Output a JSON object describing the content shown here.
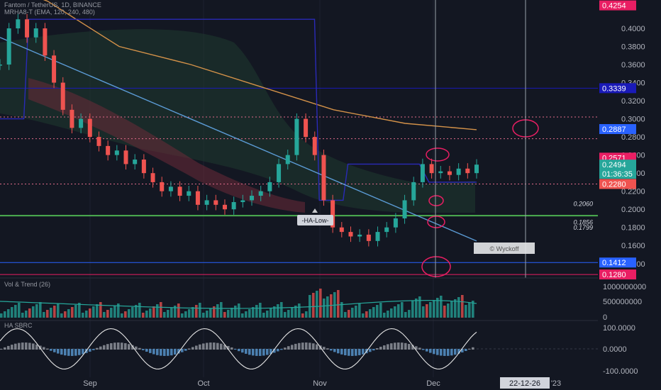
{
  "header": {
    "symbol_line": "Fantom / TetherUS, 1D, BINANCE",
    "indicator_line": "MRHA8-T (EMA, 120, 240, 480)"
  },
  "chart_data": [
    {
      "type": "candlestick",
      "title": "Fantom / TetherUS, 1D, BINANCE",
      "xlabel": "",
      "ylabel": "",
      "y_scale": "linear",
      "ylim": [
        0.125,
        0.435
      ],
      "x_tick_labels": [
        "Sep",
        "Oct",
        "Nov",
        "Dec",
        "'23"
      ],
      "y_tick_labels": [
        "0.4000",
        "0.3800",
        "0.3600",
        "0.3400",
        "0.3200",
        "0.3000",
        "0.2800",
        "0.2600",
        "0.2400",
        "0.2200",
        "0.2000",
        "0.1800",
        "0.1600",
        "0.1400"
      ],
      "price_labels": [
        {
          "text": "0.4254",
          "value": 0.4254,
          "color": "#e91e63"
        },
        {
          "text": "0.3339",
          "value": 0.3339,
          "color": "#1a1ab8"
        },
        {
          "text": "0.2887",
          "value": 0.2887,
          "color": "#2962ff"
        },
        {
          "text": "0.2571",
          "value": 0.2571,
          "color": "#e91e63"
        },
        {
          "text": "0.2494",
          "value": 0.2494,
          "color": "#26a69a"
        },
        {
          "text": "01:36:35",
          "value": 0.2494,
          "color": "#26a69a"
        },
        {
          "text": "0.2280",
          "value": 0.228,
          "color": "#ef5350"
        },
        {
          "text": "0.1412",
          "value": 0.1412,
          "color": "#2962ff"
        },
        {
          "text": "0.1280",
          "value": 0.128,
          "color": "#e91e63"
        }
      ],
      "level_annotations": [
        {
          "text": "0.2060",
          "value": 0.206
        },
        {
          "text": "0.1856",
          "value": 0.1856
        },
        {
          "text": "0.1799",
          "value": 0.1799
        }
      ],
      "callout": {
        "text": "-HA-Low-",
        "value": 0.192
      },
      "watermark_text": "© Wyckoff",
      "date_cursor_label": "22-12-26",
      "horizontal_levels": [
        {
          "value": 0.3339,
          "color": "#1a1ab8"
        },
        {
          "value": 0.193,
          "color": "#4caf50"
        },
        {
          "value": 0.302,
          "color": "#e06b8a"
        },
        {
          "value": 0.278,
          "color": "#e06b8a"
        },
        {
          "value": 0.228,
          "color": "#e06b8a"
        },
        {
          "value": 0.1412,
          "color": "#2962ff"
        },
        {
          "value": 0.128,
          "color": "#e91e63"
        }
      ],
      "close_path": [
        0.36,
        0.4,
        0.41,
        0.39,
        0.4,
        0.37,
        0.34,
        0.31,
        0.29,
        0.3,
        0.28,
        0.27,
        0.26,
        0.265,
        0.25,
        0.255,
        0.24,
        0.23,
        0.22,
        0.225,
        0.215,
        0.22,
        0.205,
        0.21,
        0.205,
        0.2,
        0.208,
        0.21,
        0.215,
        0.22,
        0.23,
        0.25,
        0.26,
        0.3,
        0.28,
        0.26,
        0.21,
        0.18,
        0.175,
        0.17,
        0.172,
        0.165,
        0.175,
        0.18,
        0.19,
        0.21,
        0.23,
        0.25,
        0.24,
        0.242,
        0.238,
        0.245,
        0.24,
        0.2494
      ],
      "series": [
        {
          "name": "",
          "color": "#d49249",
          "points": [
            [
              0,
              0.45
            ],
            [
              0.1,
              0.43
            ],
            [
              0.25,
              0.38
            ],
            [
              0.4,
              0.36
            ],
            [
              0.55,
              0.335
            ],
            [
              0.7,
              0.31
            ],
            [
              0.85,
              0.295
            ],
            [
              1.0,
              0.288
            ]
          ]
        },
        {
          "name": "",
          "color": "#2a2ab8",
          "points": [
            [
              0,
              0.3
            ],
            [
              0.05,
              0.3
            ],
            [
              0.06,
              0.41
            ],
            [
              0.66,
              0.41
            ],
            [
              0.67,
              0.21
            ],
            [
              0.72,
              0.21
            ],
            [
              0.73,
              0.25
            ],
            [
              0.88,
              0.25
            ],
            [
              0.9,
              0.23
            ],
            [
              1.0,
              0.23
            ]
          ]
        },
        {
          "name": "",
          "color": "#5b9bd5",
          "points": [
            [
              0,
              0.39
            ],
            [
              1.0,
              0.165
            ]
          ]
        }
      ]
    },
    {
      "type": "bar",
      "title": "Vol & Trend (26)",
      "y_tick_labels": [
        "1000000000",
        "500000000",
        "0"
      ],
      "ylim": [
        0,
        1000000000
      ]
    },
    {
      "type": "bar",
      "title": "HA SBRC",
      "y_tick_labels": [
        "100.0000",
        "0.0000",
        "-100.0000"
      ],
      "ylim": [
        -120,
        120
      ]
    }
  ]
}
